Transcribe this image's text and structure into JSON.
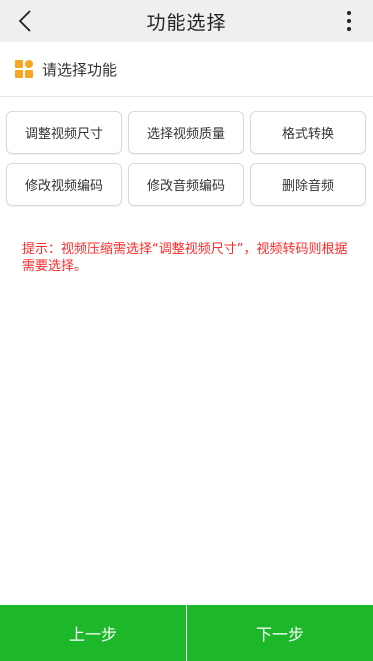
{
  "header": {
    "title": "功能选择",
    "back_icon": "chevron-left-icon",
    "more_icon": "more-vertical-icon"
  },
  "section": {
    "label": "请选择功能",
    "icon": "apps-grid-icon",
    "icon_color": "#f5a623"
  },
  "functions": [
    "调整视频尺寸",
    "选择视频质量",
    "格式转换",
    "修改视频编码",
    "修改音频编码",
    "删除音频"
  ],
  "hint": "提示：视频压缩需选择“调整视频尺寸”，视频转码则根据需要选择。",
  "footer": {
    "prev_label": "上一步",
    "next_label": "下一步",
    "color": "#1cb82a"
  },
  "colors": {
    "hint": "#ff2a2a",
    "topbar_bg": "#efefef"
  }
}
